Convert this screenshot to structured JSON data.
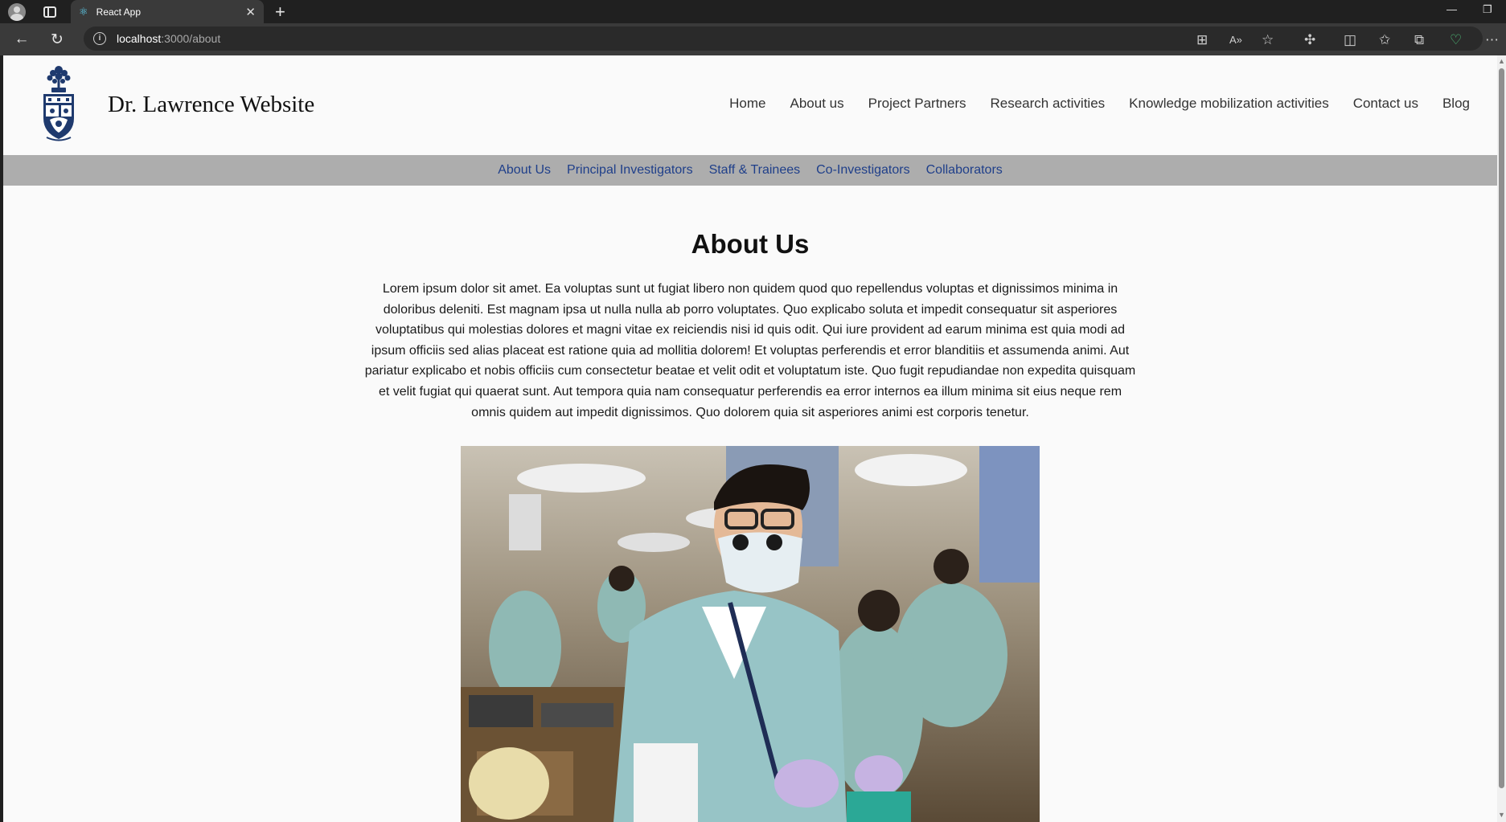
{
  "browser": {
    "tab_title": "React App",
    "url_host": "localhost",
    "url_path": ":3000/about"
  },
  "site": {
    "title": "Dr. Lawrence Website",
    "logo_icon": "university-crest-icon"
  },
  "main_nav": [
    "Home",
    "About us",
    "Project Partners",
    "Research activities",
    "Knowledge mobilization activities",
    "Contact us",
    "Blog"
  ],
  "sub_nav": [
    "About Us",
    "Principal Investigators",
    "Staff & Trainees",
    "Co-Investigators",
    "Collaborators"
  ],
  "content": {
    "heading": "About Us",
    "paragraph": "Lorem ipsum dolor sit amet. Ea voluptas sunt ut fugiat libero non quidem quod quo repellendus voluptas et dignissimos minima in doloribus deleniti. Est magnam ipsa ut nulla nulla ab porro voluptates. Quo explicabo soluta et impedit consequatur sit asperiores voluptatibus qui molestias dolores et magni vitae ex reiciendis nisi id quis odit. Qui iure provident ad earum minima est quia modi ad ipsum officiis sed alias placeat est ratione quia ad mollitia dolorem! Et voluptas perferendis et error blanditiis et assumenda animi. Aut pariatur explicabo et nobis officiis cum consectetur beatae et velit odit et voluptatum iste. Quo fugit repudiandae non expedita quisquam et velit fugiat qui quaerat sunt. Aut tempora quia nam consequatur perferendis ea error internos ea illum minima sit eius neque rem omnis quidem aut impedit dignissimos. Quo dolorem quia sit asperiores animi est corporis tenetur.",
    "photo_icon": "dental-student-photo"
  },
  "colors": {
    "subnav_bg": "#adadad",
    "subnav_link": "#1f3f8a",
    "page_bg": "#fafafa"
  }
}
